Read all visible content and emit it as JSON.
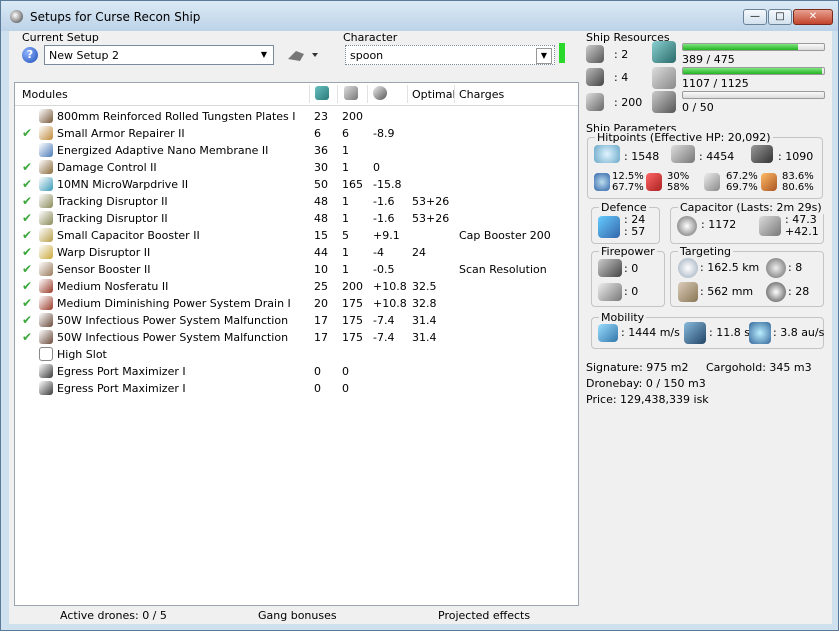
{
  "window": {
    "title": "Setups for Curse Recon Ship"
  },
  "setup": {
    "label": "Current Setup",
    "value": "New Setup 2"
  },
  "character": {
    "label": "Character",
    "value": "spoon"
  },
  "modules": {
    "headers": {
      "name": "Modules",
      "optimal": "Optimal",
      "charges": "Charges"
    },
    "rows": [
      {
        "checked": false,
        "name": "800mm Reinforced Rolled Tungsten Plates I",
        "cpu": "23",
        "pg": "200",
        "cap": "",
        "optimal": "",
        "charges": "",
        "icon": "armor-plate-icon",
        "color": "#7a5a3a"
      },
      {
        "checked": true,
        "name": "Small Armor Repairer II",
        "cpu": "6",
        "pg": "6",
        "cap": "-8.9",
        "optimal": "",
        "charges": "",
        "icon": "armor-repairer-icon",
        "color": "#c08a3a"
      },
      {
        "checked": false,
        "name": "Energized Adaptive Nano Membrane II",
        "cpu": "36",
        "pg": "1",
        "cap": "",
        "optimal": "",
        "charges": "",
        "icon": "nano-membrane-icon",
        "color": "#4a7ab8"
      },
      {
        "checked": true,
        "name": "Damage Control II",
        "cpu": "30",
        "pg": "1",
        "cap": "0",
        "optimal": "",
        "charges": "",
        "icon": "damage-control-icon",
        "color": "#8a6a3a"
      },
      {
        "checked": true,
        "name": "10MN MicroWarpdrive II",
        "cpu": "50",
        "pg": "165",
        "cap": "-15.8",
        "optimal": "",
        "charges": "",
        "icon": "microwarpdrive-icon",
        "color": "#3a9ab8"
      },
      {
        "checked": true,
        "name": "Tracking Disruptor II",
        "cpu": "48",
        "pg": "1",
        "cap": "-1.6",
        "optimal": "53+26",
        "charges": "",
        "icon": "tracking-disruptor-icon",
        "color": "#8a8a5a"
      },
      {
        "checked": true,
        "name": "Tracking Disruptor II",
        "cpu": "48",
        "pg": "1",
        "cap": "-1.6",
        "optimal": "53+26",
        "charges": "",
        "icon": "tracking-disruptor-icon",
        "color": "#8a8a5a"
      },
      {
        "checked": true,
        "name": "Small Capacitor Booster II",
        "cpu": "15",
        "pg": "5",
        "cap": "+9.1",
        "optimal": "",
        "charges": "Cap Booster 200",
        "icon": "capacitor-booster-icon",
        "color": "#b8a04a"
      },
      {
        "checked": true,
        "name": "Warp Disruptor II",
        "cpu": "44",
        "pg": "1",
        "cap": "-4",
        "optimal": "24",
        "charges": "",
        "icon": "warp-disruptor-icon",
        "color": "#c8a83a"
      },
      {
        "checked": true,
        "name": "Sensor Booster II",
        "cpu": "10",
        "pg": "1",
        "cap": "-0.5",
        "optimal": "",
        "charges": "Scan Resolution",
        "icon": "sensor-booster-icon",
        "color": "#9a7a5a"
      },
      {
        "checked": true,
        "name": "Medium Nosferatu II",
        "cpu": "25",
        "pg": "200",
        "cap": "+10.8",
        "optimal": "32.5",
        "charges": "",
        "icon": "nosferatu-icon",
        "color": "#9a3a2a"
      },
      {
        "checked": true,
        "name": "Medium Diminishing Power System Drain I",
        "cpu": "20",
        "pg": "175",
        "cap": "+10.8",
        "optimal": "32.8",
        "charges": "",
        "icon": "power-drain-icon",
        "color": "#9a3a2a"
      },
      {
        "checked": true,
        "name": "50W Infectious Power System Malfunction",
        "cpu": "17",
        "pg": "175",
        "cap": "-7.4",
        "optimal": "31.4",
        "charges": "",
        "icon": "neutralizer-icon",
        "color": "#6a4a3a"
      },
      {
        "checked": true,
        "name": "50W Infectious Power System Malfunction",
        "cpu": "17",
        "pg": "175",
        "cap": "-7.4",
        "optimal": "31.4",
        "charges": "",
        "icon": "neutralizer-icon",
        "color": "#6a4a3a"
      },
      {
        "checked": false,
        "name": "High Slot",
        "cpu": "",
        "pg": "",
        "cap": "",
        "optimal": "",
        "charges": "",
        "icon": "empty-slot-icon",
        "color": "#ffffff"
      },
      {
        "checked": false,
        "name": "Egress Port Maximizer I",
        "cpu": "0",
        "pg": "0",
        "cap": "",
        "optimal": "",
        "charges": "",
        "icon": "rig-icon",
        "color": "#3a3a3a"
      },
      {
        "checked": false,
        "name": "Egress Port Maximizer I",
        "cpu": "0",
        "pg": "0",
        "cap": "",
        "optimal": "",
        "charges": "",
        "icon": "rig-icon",
        "color": "#3a3a3a"
      }
    ]
  },
  "status": {
    "drones": "Active drones: 0 / 5",
    "gang": "Gang bonuses",
    "projected": "Projected effects"
  },
  "resources": {
    "title": "Ship Resources",
    "turrets": ": 2",
    "launchers": ": 4",
    "drone_bw": ": 200",
    "cpu_text": "389 / 475",
    "cpu_frac": 0.819,
    "pg_text": "1107 / 1125",
    "pg_frac": 0.984,
    "calib_text": "0 / 50",
    "calib_frac": 0
  },
  "params": {
    "title": "Ship Parameters",
    "hp_title": "Hitpoints (Effective HP: 20,092)",
    "shield_hp": ": 1548",
    "armor_hp": ": 4454",
    "structure_hp": ": 1090",
    "em": [
      "12.5%",
      "67.7%"
    ],
    "thermal": [
      "30%",
      "58%"
    ],
    "kinetic": [
      "67.2%",
      "69.7%"
    ],
    "explosive": [
      "83.6%",
      "80.6%"
    ],
    "defence_title": "Defence",
    "defence_a": ": 24",
    "defence_b": ": 57",
    "cap_title": "Capacitor (Lasts: 2m 29s)",
    "cap_amount": ": 1172",
    "cap_a": ": 47.3",
    "cap_b": "+42.1",
    "fire_title": "Firepower",
    "fire_a": ": 0",
    "fire_b": ": 0",
    "target_title": "Targeting",
    "range": ": 162.5 km",
    "max_targets": ": 8",
    "scan_res": ": 562 mm",
    "sensor": ": 28",
    "mobility_title": "Mobility",
    "speed": ": 1444 m/s",
    "align": ": 11.8 s",
    "warp": ": 3.8 au/s",
    "signature": "Signature: 975 m2",
    "cargohold": "Cargohold: 345 m3",
    "dronebay": "Dronebay: 0 / 150 m3",
    "price": "Price: 129,438,339 isk"
  }
}
